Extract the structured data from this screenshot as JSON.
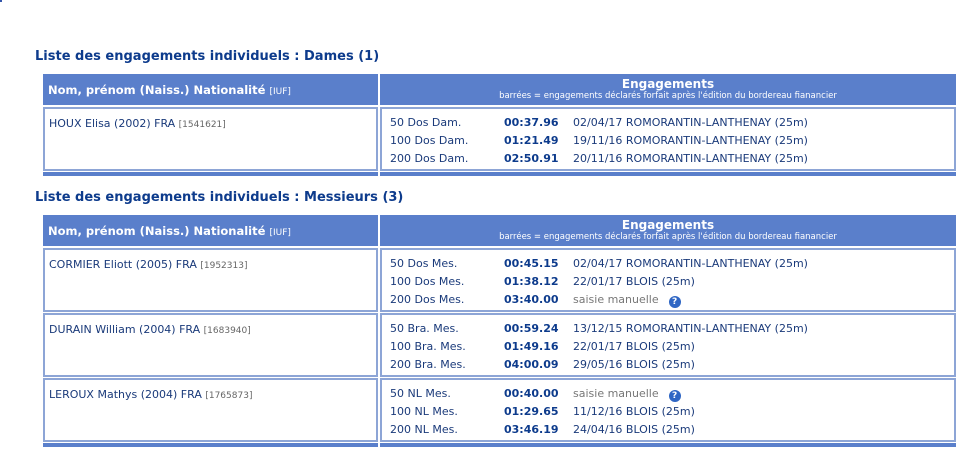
{
  "table_header": {
    "name_col": "Nom, prénom (Naiss.) Nationalité",
    "name_col_iuf": "[IUF]",
    "eng_col": "Engagements",
    "eng_col_note": "barrées = engagements déclarés forfait après l'édition du bordereau fianancier"
  },
  "sections": [
    {
      "title": "Liste des engagements individuels : Dames (1)",
      "swimmers": [
        {
          "name": "HOUX Elisa (2002) FRA",
          "iuf": "[1541621]",
          "entries": [
            {
              "event": "50 Dos Dam.",
              "time": "00:37.96",
              "detail": "02/04/17 ROMORANTIN-LANTHENAY (25m)",
              "manual": false
            },
            {
              "event": "100 Dos Dam.",
              "time": "01:21.49",
              "detail": "19/11/16 ROMORANTIN-LANTHENAY (25m)",
              "manual": false
            },
            {
              "event": "200 Dos Dam.",
              "time": "02:50.91",
              "detail": "20/11/16 ROMORANTIN-LANTHENAY (25m)",
              "manual": false
            }
          ]
        }
      ]
    },
    {
      "title": "Liste des engagements individuels : Messieurs (3)",
      "swimmers": [
        {
          "name": "CORMIER Eliott (2005) FRA",
          "iuf": "[1952313]",
          "entries": [
            {
              "event": "50 Dos Mes.",
              "time": "00:45.15",
              "detail": "02/04/17 ROMORANTIN-LANTHENAY (25m)",
              "manual": false
            },
            {
              "event": "100 Dos Mes.",
              "time": "01:38.12",
              "detail": "22/01/17 BLOIS (25m)",
              "manual": false
            },
            {
              "event": "200 Dos Mes.",
              "time": "03:40.00",
              "detail": "saisie manuelle",
              "manual": true
            }
          ]
        },
        {
          "name": "DURAIN William (2004) FRA",
          "iuf": "[1683940]",
          "entries": [
            {
              "event": "50 Bra. Mes.",
              "time": "00:59.24",
              "detail": "13/12/15 ROMORANTIN-LANTHENAY (25m)",
              "manual": false
            },
            {
              "event": "100 Bra. Mes.",
              "time": "01:49.16",
              "detail": "22/01/17 BLOIS (25m)",
              "manual": false
            },
            {
              "event": "200 Bra. Mes.",
              "time": "04:00.09",
              "detail": "29/05/16 BLOIS (25m)",
              "manual": false
            }
          ]
        },
        {
          "name": "LEROUX Mathys (2004) FRA",
          "iuf": "[1765873]",
          "entries": [
            {
              "event": "50 NL Mes.",
              "time": "00:40.00",
              "detail": "saisie manuelle",
              "manual": true
            },
            {
              "event": "100 NL Mes.",
              "time": "01:29.65",
              "detail": "11/12/16 BLOIS (25m)",
              "manual": false
            },
            {
              "event": "200 NL Mes.",
              "time": "03:46.19",
              "detail": "24/04/16 BLOIS (25m)",
              "manual": false
            }
          ]
        }
      ]
    }
  ],
  "icons": {
    "help": "help-icon"
  },
  "colors": {
    "header_bg": "#5a7fcb",
    "border": "#8da5d6",
    "title": "#0d3b8c"
  }
}
